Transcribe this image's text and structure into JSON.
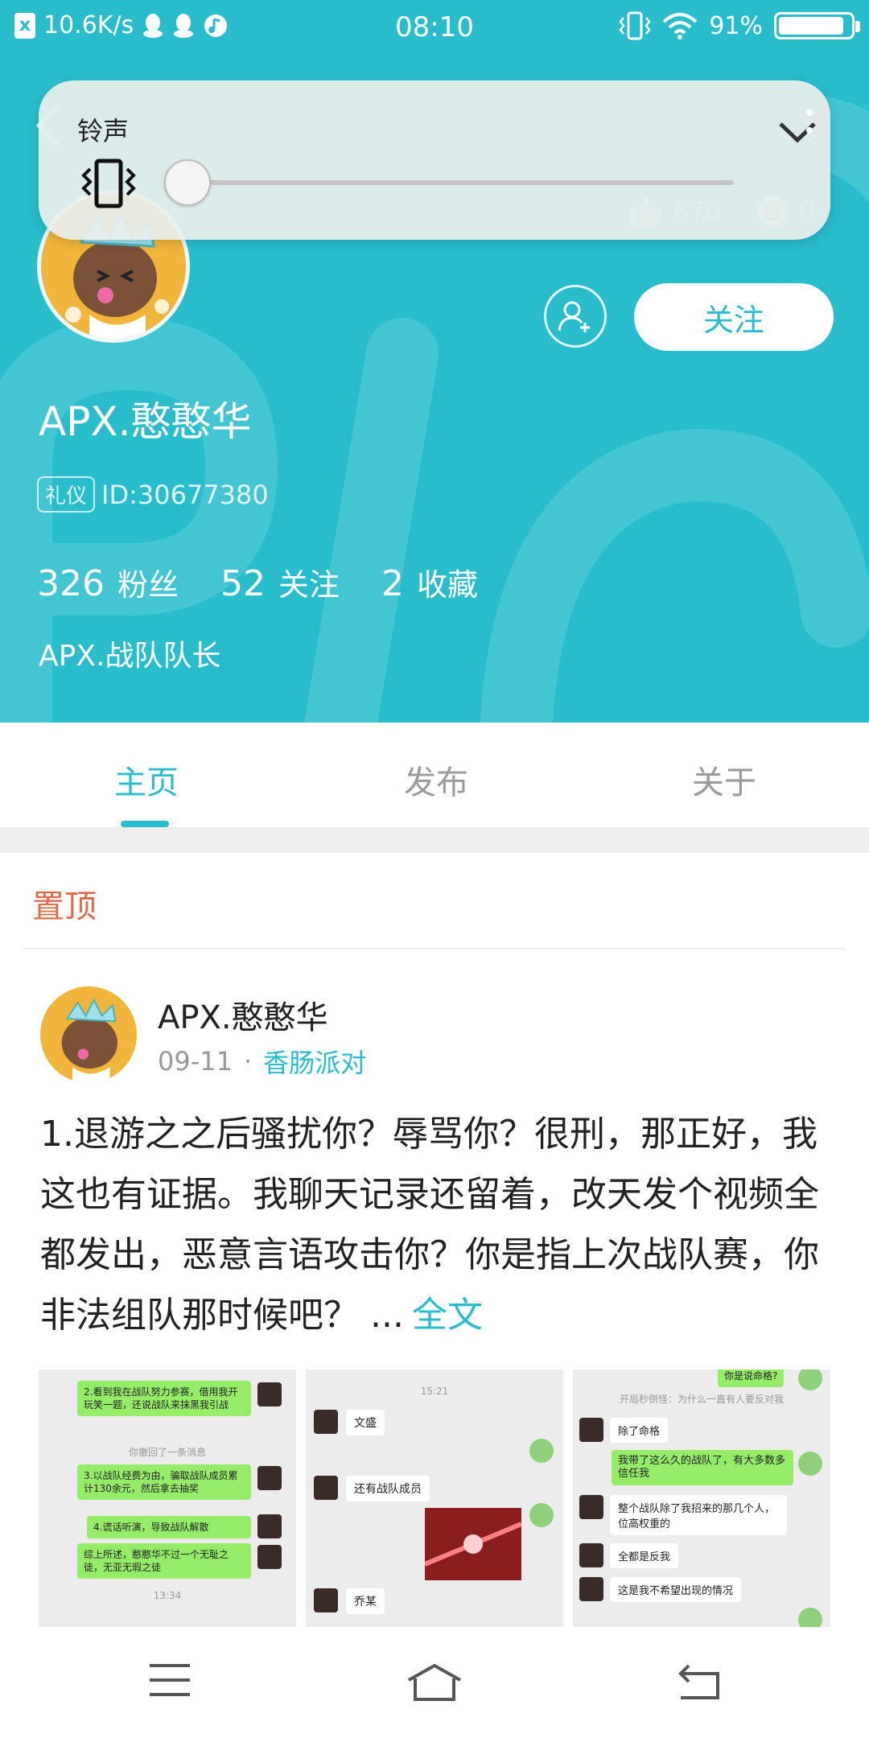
{
  "status_bar": {
    "network_speed": "10.6K/s",
    "time": "08:10",
    "battery": "91%",
    "battery_level": 0.91,
    "icons": [
      "app-x-icon",
      "qq-icon",
      "qq-icon",
      "music-icon",
      "vibrate-icon",
      "wifi-icon",
      "battery-icon"
    ]
  },
  "volume_overlay": {
    "title": "铃声",
    "level": 0,
    "mode_icon": "vibrate-icon",
    "collapse_icon": "chevron-down-icon"
  },
  "header": {
    "like_count": "670",
    "comment_count": "0"
  },
  "profile": {
    "username": "APX.憨憨华",
    "tag": "礼仪",
    "id_text": "ID:30677380",
    "follow_label": "关注",
    "stats": [
      {
        "num": "326",
        "label": "粉丝"
      },
      {
        "num": "52",
        "label": "关注"
      },
      {
        "num": "2",
        "label": "收藏"
      }
    ],
    "bio": "APX.战队队长"
  },
  "tabs": [
    {
      "label": "主页",
      "active": true
    },
    {
      "label": "发布",
      "active": false
    },
    {
      "label": "关于",
      "active": false
    }
  ],
  "content": {
    "pinned_label": "置顶",
    "post": {
      "author": "APX.憨憨华",
      "date": "09-11",
      "separator": "·",
      "group": "香肠派对",
      "text": "1.退游之之后骚扰你？辱骂你？很刑，那正好，我这也有证据。我聊天记录还留着，改天发个视频全都发出，恶意言语攻击你？你是指上次战队赛，你非法组队那时候吧？ ...",
      "full_text_label": "全文"
    },
    "thumbs": [
      {
        "bubbles": [
          "2.看到我在战队努力参赛，借用我开玩笑一题，还说战队来抹黑我引战",
          "3.以战队经费为由，骗取战队成员累计130余元，然后拿去抽奖",
          "4.谎话听演，导致战队解散",
          "综上所述，憨憨华不过一个无耻之徒，无亚无瑕之徒"
        ],
        "system": "你撤回了一条消息",
        "timestamp": "13:34"
      },
      {
        "timestamp": "15:21",
        "messages": [
          "文盛",
          "还有战队成员",
          "乔某"
        ]
      },
      {
        "top_bubble": "你是说命格?",
        "system": "开局秒倒怪：为什么一直有人要反对我",
        "messages_white": [
          "除了命格",
          "整个战队除了我招来的那几个人，位高权重的",
          "全都是反我",
          "这是我不希望出现的情况"
        ],
        "message_green": "我带了这么久的战队了，有大多数多信任我"
      }
    ]
  },
  "navbar": {
    "icons": [
      "menu-icon",
      "home-icon",
      "back-icon"
    ]
  },
  "colors": {
    "accent": "#29bdcc",
    "pinned": "#e26a4a",
    "chat_green": "#95ec69"
  }
}
